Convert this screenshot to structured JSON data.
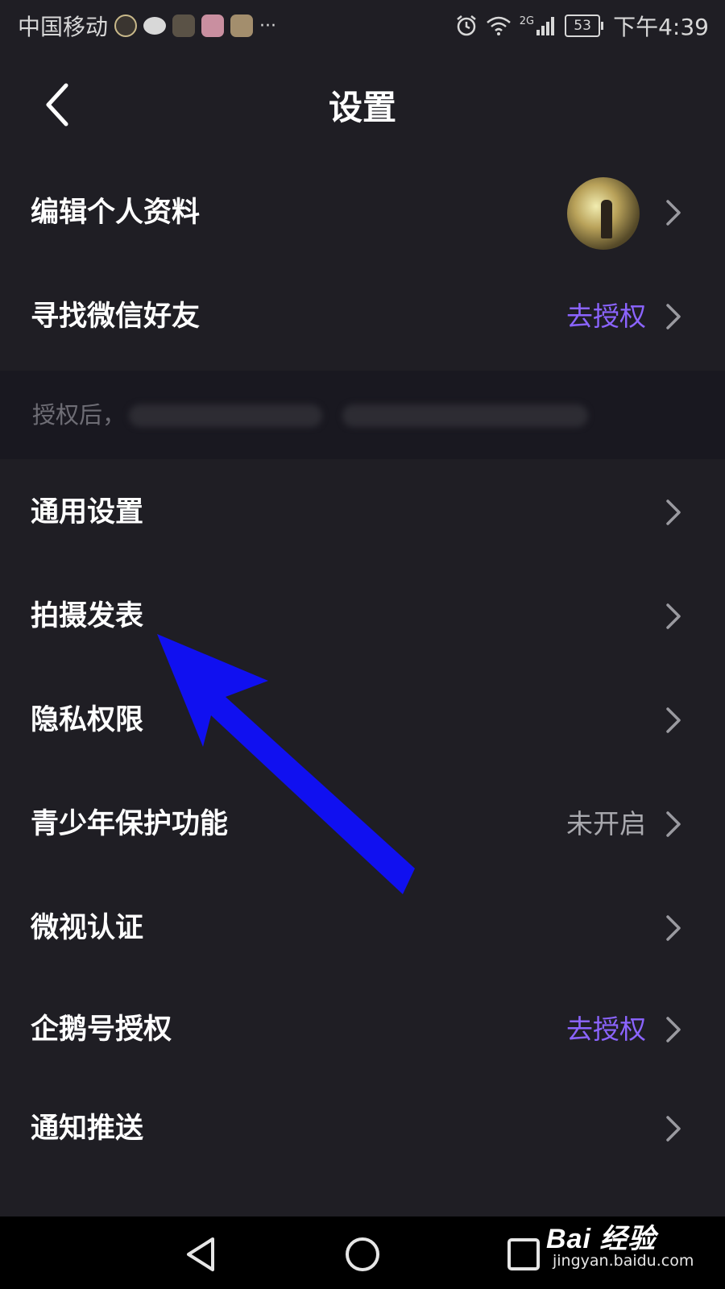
{
  "status_bar": {
    "carrier": "中国移动",
    "more": "···",
    "network": "2G",
    "battery": "53",
    "time": "下午4:39"
  },
  "header": {
    "title": "设置"
  },
  "rows": [
    {
      "label": "编辑个人资料",
      "value": ""
    },
    {
      "label": "寻找微信好友",
      "value": "去授权"
    },
    {
      "label": "通用设置",
      "value": ""
    },
    {
      "label": "拍摄发表",
      "value": ""
    },
    {
      "label": "隐私权限",
      "value": ""
    },
    {
      "label": "青少年保护功能",
      "value": "未开启"
    },
    {
      "label": "微视认证",
      "value": ""
    },
    {
      "label": "企鹅号授权",
      "value": "去授权"
    },
    {
      "label": "通知推送",
      "value": ""
    }
  ],
  "hint": {
    "text": "授权后，"
  },
  "colors": {
    "background": "#1f1e24",
    "accent": "#8b64ff",
    "annotation_arrow": "#1010f0"
  },
  "icons": {
    "back": "chevron-left-icon",
    "row_arrow": "chevron-right-icon",
    "nav_back": "triangle-back-icon",
    "nav_home": "circle-home-icon",
    "nav_recent": "square-recent-icon"
  },
  "watermark": {
    "logo": "Bai 经验",
    "sub": "jingyan.baidu.com"
  }
}
